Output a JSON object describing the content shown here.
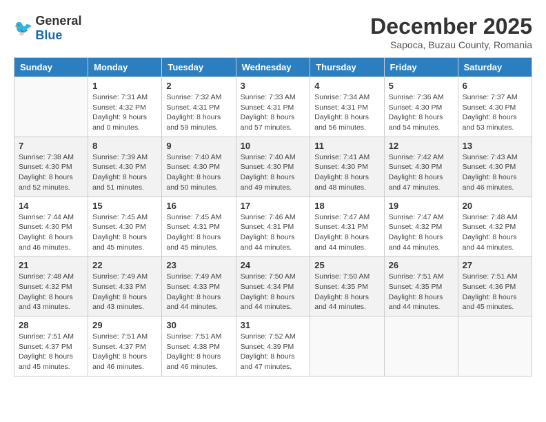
{
  "header": {
    "logo_general": "General",
    "logo_blue": "Blue",
    "month_year": "December 2025",
    "location": "Sapoca, Buzau County, Romania"
  },
  "weekdays": [
    "Sunday",
    "Monday",
    "Tuesday",
    "Wednesday",
    "Thursday",
    "Friday",
    "Saturday"
  ],
  "weeks": [
    [
      {
        "day": "",
        "info": ""
      },
      {
        "day": "1",
        "info": "Sunrise: 7:31 AM\nSunset: 4:32 PM\nDaylight: 9 hours\nand 0 minutes."
      },
      {
        "day": "2",
        "info": "Sunrise: 7:32 AM\nSunset: 4:31 PM\nDaylight: 8 hours\nand 59 minutes."
      },
      {
        "day": "3",
        "info": "Sunrise: 7:33 AM\nSunset: 4:31 PM\nDaylight: 8 hours\nand 57 minutes."
      },
      {
        "day": "4",
        "info": "Sunrise: 7:34 AM\nSunset: 4:31 PM\nDaylight: 8 hours\nand 56 minutes."
      },
      {
        "day": "5",
        "info": "Sunrise: 7:36 AM\nSunset: 4:30 PM\nDaylight: 8 hours\nand 54 minutes."
      },
      {
        "day": "6",
        "info": "Sunrise: 7:37 AM\nSunset: 4:30 PM\nDaylight: 8 hours\nand 53 minutes."
      }
    ],
    [
      {
        "day": "7",
        "info": "Sunrise: 7:38 AM\nSunset: 4:30 PM\nDaylight: 8 hours\nand 52 minutes."
      },
      {
        "day": "8",
        "info": "Sunrise: 7:39 AM\nSunset: 4:30 PM\nDaylight: 8 hours\nand 51 minutes."
      },
      {
        "day": "9",
        "info": "Sunrise: 7:40 AM\nSunset: 4:30 PM\nDaylight: 8 hours\nand 50 minutes."
      },
      {
        "day": "10",
        "info": "Sunrise: 7:40 AM\nSunset: 4:30 PM\nDaylight: 8 hours\nand 49 minutes."
      },
      {
        "day": "11",
        "info": "Sunrise: 7:41 AM\nSunset: 4:30 PM\nDaylight: 8 hours\nand 48 minutes."
      },
      {
        "day": "12",
        "info": "Sunrise: 7:42 AM\nSunset: 4:30 PM\nDaylight: 8 hours\nand 47 minutes."
      },
      {
        "day": "13",
        "info": "Sunrise: 7:43 AM\nSunset: 4:30 PM\nDaylight: 8 hours\nand 46 minutes."
      }
    ],
    [
      {
        "day": "14",
        "info": "Sunrise: 7:44 AM\nSunset: 4:30 PM\nDaylight: 8 hours\nand 46 minutes."
      },
      {
        "day": "15",
        "info": "Sunrise: 7:45 AM\nSunset: 4:30 PM\nDaylight: 8 hours\nand 45 minutes."
      },
      {
        "day": "16",
        "info": "Sunrise: 7:45 AM\nSunset: 4:31 PM\nDaylight: 8 hours\nand 45 minutes."
      },
      {
        "day": "17",
        "info": "Sunrise: 7:46 AM\nSunset: 4:31 PM\nDaylight: 8 hours\nand 44 minutes."
      },
      {
        "day": "18",
        "info": "Sunrise: 7:47 AM\nSunset: 4:31 PM\nDaylight: 8 hours\nand 44 minutes."
      },
      {
        "day": "19",
        "info": "Sunrise: 7:47 AM\nSunset: 4:32 PM\nDaylight: 8 hours\nand 44 minutes."
      },
      {
        "day": "20",
        "info": "Sunrise: 7:48 AM\nSunset: 4:32 PM\nDaylight: 8 hours\nand 44 minutes."
      }
    ],
    [
      {
        "day": "21",
        "info": "Sunrise: 7:48 AM\nSunset: 4:32 PM\nDaylight: 8 hours\nand 43 minutes."
      },
      {
        "day": "22",
        "info": "Sunrise: 7:49 AM\nSunset: 4:33 PM\nDaylight: 8 hours\nand 43 minutes."
      },
      {
        "day": "23",
        "info": "Sunrise: 7:49 AM\nSunset: 4:33 PM\nDaylight: 8 hours\nand 44 minutes."
      },
      {
        "day": "24",
        "info": "Sunrise: 7:50 AM\nSunset: 4:34 PM\nDaylight: 8 hours\nand 44 minutes."
      },
      {
        "day": "25",
        "info": "Sunrise: 7:50 AM\nSunset: 4:35 PM\nDaylight: 8 hours\nand 44 minutes."
      },
      {
        "day": "26",
        "info": "Sunrise: 7:51 AM\nSunset: 4:35 PM\nDaylight: 8 hours\nand 44 minutes."
      },
      {
        "day": "27",
        "info": "Sunrise: 7:51 AM\nSunset: 4:36 PM\nDaylight: 8 hours\nand 45 minutes."
      }
    ],
    [
      {
        "day": "28",
        "info": "Sunrise: 7:51 AM\nSunset: 4:37 PM\nDaylight: 8 hours\nand 45 minutes."
      },
      {
        "day": "29",
        "info": "Sunrise: 7:51 AM\nSunset: 4:37 PM\nDaylight: 8 hours\nand 46 minutes."
      },
      {
        "day": "30",
        "info": "Sunrise: 7:51 AM\nSunset: 4:38 PM\nDaylight: 8 hours\nand 46 minutes."
      },
      {
        "day": "31",
        "info": "Sunrise: 7:52 AM\nSunset: 4:39 PM\nDaylight: 8 hours\nand 47 minutes."
      },
      {
        "day": "",
        "info": ""
      },
      {
        "day": "",
        "info": ""
      },
      {
        "day": "",
        "info": ""
      }
    ]
  ]
}
